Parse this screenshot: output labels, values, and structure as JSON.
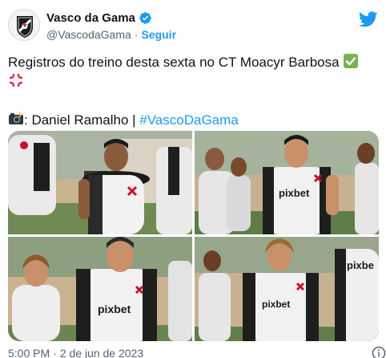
{
  "account": {
    "display_name": "Vasco da Gama",
    "handle": "@VascodaGama",
    "separator": "·",
    "follow_label": "Seguir",
    "verified": true,
    "avatar_icon": "vasco-crest-icon"
  },
  "tweet": {
    "line1": "Registros do treino desta sexta no CT Moacyr Barbosa",
    "credit_prefix": ": Daniel Ramalho | ",
    "hashtag": "#VascoDaGama",
    "emojis": [
      "check-mark-icon",
      "anger-symbol-icon",
      "camera-flash-icon"
    ]
  },
  "photos": [
    {
      "name": "photo-training-1"
    },
    {
      "name": "photo-training-2"
    },
    {
      "name": "photo-training-3"
    },
    {
      "name": "photo-training-4"
    }
  ],
  "footer": {
    "time": "5:00 PM",
    "separator": "·",
    "date": "2 de jun de 2023"
  },
  "colors": {
    "accent": "#1d9bf0",
    "text": "#0f1419",
    "muted": "#536471"
  }
}
